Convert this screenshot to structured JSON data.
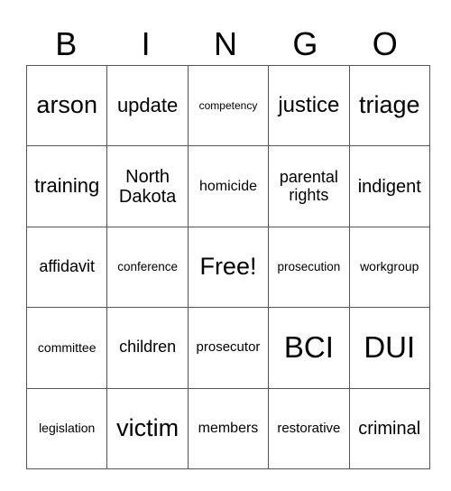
{
  "header": [
    "B",
    "I",
    "N",
    "G",
    "O"
  ],
  "rows": [
    [
      "arson",
      "update",
      "competency",
      "justice",
      "triage"
    ],
    [
      "training",
      "North Dakota",
      "homicide",
      "parental rights",
      "indigent"
    ],
    [
      "affidavit",
      "conference",
      "Free!",
      "prosecution",
      "workgroup"
    ],
    [
      "committee",
      "children",
      "prosecutor",
      "BCI",
      "DUI"
    ],
    [
      "legislation",
      "victim",
      "members",
      "restorative",
      "criminal"
    ]
  ]
}
